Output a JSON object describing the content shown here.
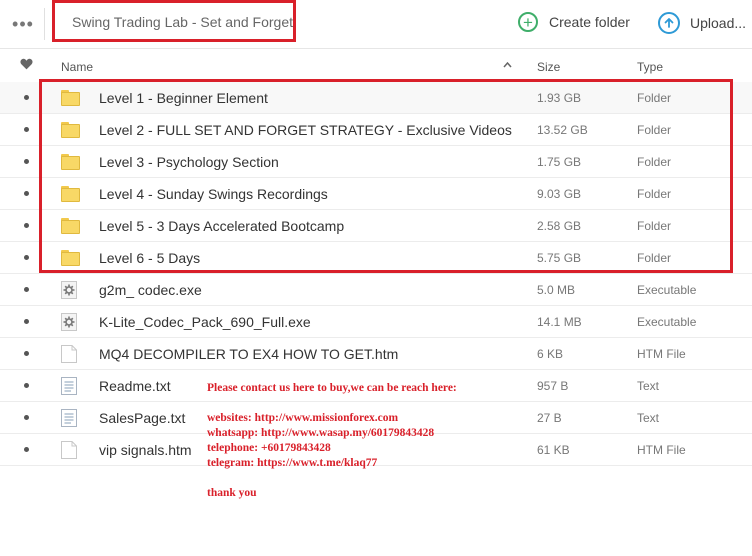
{
  "topbar": {
    "title": "Swing Trading Lab - Set and Forget",
    "create_folder_label": "Create folder",
    "upload_label": "Upload..."
  },
  "header": {
    "name": "Name",
    "size": "Size",
    "type": "Type",
    "sort_indicator": "^"
  },
  "files": [
    {
      "name": "Level 1 - Beginner Element",
      "size": "1.93 GB",
      "type": "Folder",
      "icon": "folder-icon"
    },
    {
      "name": "Level 2 - FULL SET AND FORGET STRATEGY - Exclusive Videos",
      "size": "13.52 GB",
      "type": "Folder",
      "icon": "folder-icon"
    },
    {
      "name": "Level 3 - Psychology Section",
      "size": "1.75 GB",
      "type": "Folder",
      "icon": "folder-icon"
    },
    {
      "name": "Level 4 - Sunday Swings Recordings",
      "size": "9.03 GB",
      "type": "Folder",
      "icon": "folder-icon"
    },
    {
      "name": "Level 5 - 3 Days Accelerated Bootcamp",
      "size": "2.58 GB",
      "type": "Folder",
      "icon": "folder-icon"
    },
    {
      "name": "Level 6 - 5 Days",
      "size": "5.75 GB",
      "type": "Folder",
      "icon": "folder-icon"
    },
    {
      "name": "g2m_ codec.exe",
      "size": "5.0 MB",
      "type": "Executable",
      "icon": "gear-file-icon"
    },
    {
      "name": "K-Lite_Codec_Pack_690_Full.exe",
      "size": "14.1 MB",
      "type": "Executable",
      "icon": "gear-file-icon"
    },
    {
      "name": "MQ4 DECOMPILER TO EX4 HOW TO GET.htm",
      "size": "6 KB",
      "type": "HTM File",
      "icon": "blank-file-icon"
    },
    {
      "name": "Readme.txt",
      "size": "957 B",
      "type": "Text",
      "icon": "text-file-icon"
    },
    {
      "name": "SalesPage.txt",
      "size": "27 B",
      "type": "Text",
      "icon": "text-file-icon"
    },
    {
      "name": "vip signals.htm",
      "size": "61 KB",
      "type": "HTM File",
      "icon": "blank-file-icon"
    }
  ],
  "contact_note": {
    "line1": "Please contact us here to buy,we can be reach here:",
    "line2": "",
    "line3": "websites: http://www.missionforex.com",
    "line4": "whatsapp: http://www.wasap.my/60179843428",
    "line5": "telephone: +60179843428",
    "line6": "telegram: https://www.t.me/klaq77",
    "line7": "",
    "line8": "thank you"
  },
  "colors": {
    "annotation_red": "#d9202a",
    "create_green": "#3fae6a",
    "upload_blue": "#2e9ad6",
    "folder_yellow": "#f8d866"
  }
}
